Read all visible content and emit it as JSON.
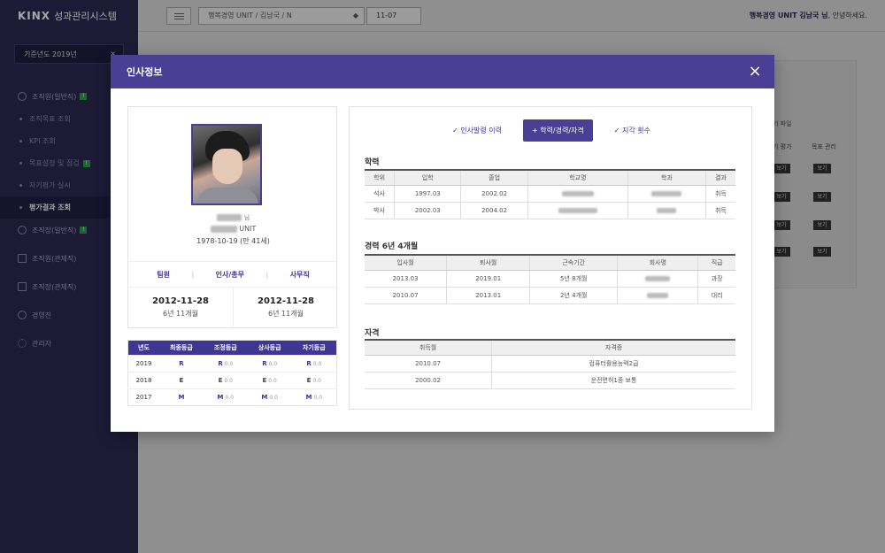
{
  "app": {
    "brand": "KINX",
    "system_name": "성과관리시스템"
  },
  "sidebar": {
    "year_select": "기준년도 2019년",
    "groups": [
      {
        "label": "조직원(일반직)",
        "badge": "!"
      },
      {
        "label": "조직장(일반직)",
        "badge": "!"
      },
      {
        "label": "조직원(관제직)"
      },
      {
        "label": "조직장(관제직)"
      },
      {
        "label": "경영진"
      },
      {
        "label": "관리자"
      }
    ],
    "subitems": [
      "조직목표 조회",
      "KPI 조회",
      "목표설정 및 점검",
      "자기평가 실시",
      "평가결과 조회"
    ],
    "subitem_badge": "!"
  },
  "topbar": {
    "breadcrumb": "행복경영 UNIT  /  김남국  /  N",
    "date": "11-07",
    "greeting_user": "행복경영 UNIT 김남국 님",
    "greeting_suffix": ", 안녕하세요."
  },
  "background_panel": {
    "header": "기 파일",
    "col1": "기 평가",
    "col2": "목표 관리",
    "view": "보기"
  },
  "modal": {
    "title": "인사정보",
    "close": "×",
    "profile": {
      "name_suffix": "님",
      "unit_suffix": "UNIT",
      "birth": "1978-10-19 (만 41세)",
      "roles": [
        "팀원",
        "인사/총무",
        "사무직"
      ],
      "dates": [
        {
          "date": "2012-11-28",
          "duration": "6년 11개월"
        },
        {
          "date": "2012-11-28",
          "duration": "6년 11개월"
        }
      ]
    },
    "grades": {
      "headers": [
        "년도",
        "최종등급",
        "조정등급",
        "상사등급",
        "자기등급"
      ],
      "rows": [
        {
          "year": "2019",
          "final": "R",
          "adjust": "R",
          "boss": "R",
          "self": "R",
          "score": "0.0"
        },
        {
          "year": "2018",
          "final": "E",
          "adjust": "E",
          "boss": "E",
          "self": "E",
          "score": "0.0"
        },
        {
          "year": "2017",
          "final": "M",
          "adjust": "M",
          "boss": "M",
          "self": "M",
          "score": "0.0"
        }
      ]
    },
    "tabs": [
      "✓ 인사발령 이력",
      "+ 학력/경력/자격",
      "✓ 지각 횟수"
    ],
    "education": {
      "title": "학력",
      "headers": [
        "학위",
        "입학",
        "졸업",
        "학교명",
        "학과",
        "결과"
      ],
      "rows": [
        [
          "석사",
          "1997.03",
          "2002.02",
          "",
          "",
          "취득"
        ],
        [
          "박사",
          "2002.03",
          "2004.02",
          "",
          "",
          "취득"
        ]
      ]
    },
    "career": {
      "title": "경력 6년 4개월",
      "headers": [
        "입사월",
        "퇴사월",
        "근속기간",
        "회사명",
        "직급"
      ],
      "rows": [
        [
          "2013.03",
          "2019.01",
          "5년 8개월",
          "",
          "과장"
        ],
        [
          "2010.07",
          "2013.01",
          "2년 4개월",
          "",
          "대리"
        ]
      ]
    },
    "license": {
      "title": "자격",
      "headers": [
        "취득월",
        "자격증"
      ],
      "rows": [
        [
          "2010.07",
          "컴퓨터활용능력2급"
        ],
        [
          "2000.02",
          "운전면허1종 보통"
        ]
      ]
    }
  }
}
